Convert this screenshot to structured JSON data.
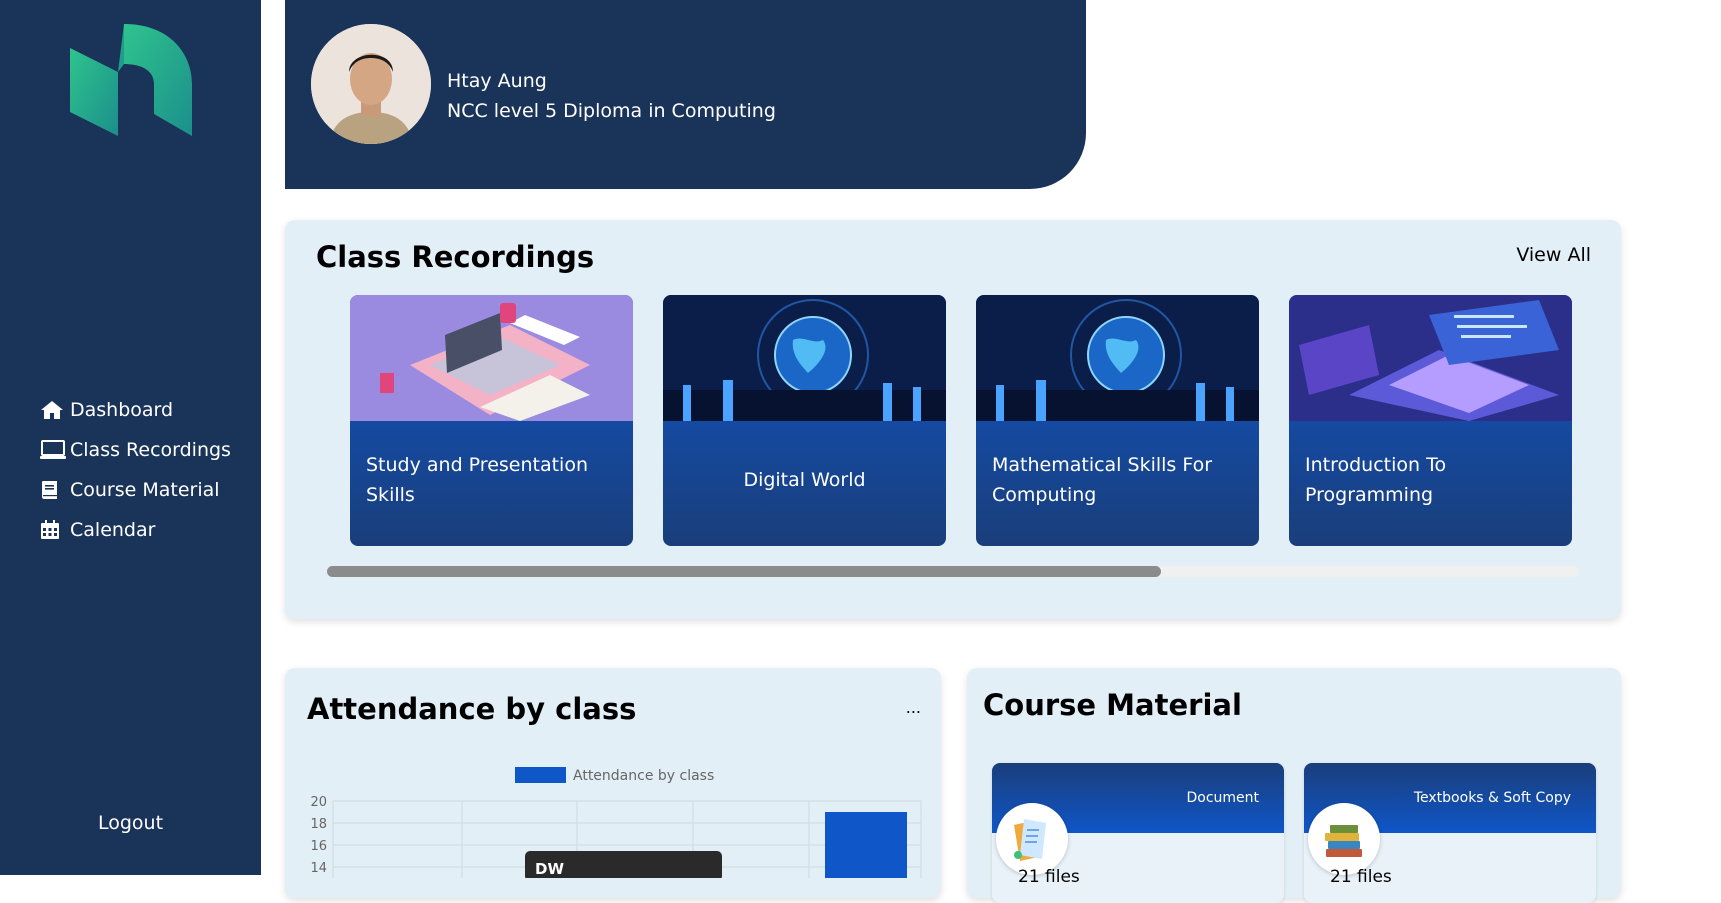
{
  "sidebar": {
    "items": [
      {
        "label": "Dashboard",
        "icon": "home-icon"
      },
      {
        "label": "Class Recordings",
        "icon": "monitor-icon"
      },
      {
        "label": "Course Material",
        "icon": "book-icon"
      },
      {
        "label": "Calendar",
        "icon": "calendar-icon"
      }
    ],
    "logout": "Logout"
  },
  "profile": {
    "name": "Htay Aung",
    "course": "NCC level 5 Diploma in Computing"
  },
  "recordings": {
    "title": "Class Recordings",
    "view_all": "View All",
    "cards": [
      {
        "label": "Study and Presentation Skills"
      },
      {
        "label": "Digital World"
      },
      {
        "label": "Mathematical Skills For Computing"
      },
      {
        "label": "Introduction To Programming"
      }
    ]
  },
  "attendance": {
    "title": "Attendance by class",
    "menu": "..."
  },
  "material": {
    "title": "Course Material",
    "cards": [
      {
        "title": "Document",
        "files": "21 files"
      },
      {
        "title": "Textbooks & Soft Copy",
        "files": "21 files"
      }
    ]
  },
  "colors": {
    "sidebar": "#1a3359",
    "panel": "#e2eff6",
    "accent": "#0f56c9"
  },
  "chart_data": {
    "type": "bar",
    "legend": "Attendance by class",
    "legend_position": "top",
    "y_ticks": [
      14,
      16,
      18,
      20
    ],
    "ylim": [
      0,
      20
    ],
    "grid": true,
    "last_bar_value": 19,
    "tooltip": "DW"
  }
}
